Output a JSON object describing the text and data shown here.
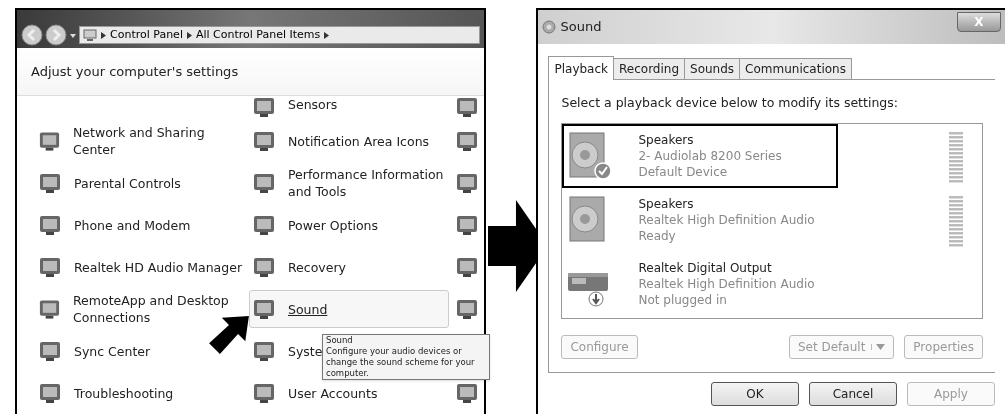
{
  "control_panel": {
    "breadcrumbs": [
      "Control Panel",
      "All Control Panel Items"
    ],
    "heading": "Adjust your computer's settings",
    "rows": [
      {
        "left": null,
        "middle": {
          "label": "Sensors",
          "selected": false
        }
      },
      {
        "left": {
          "label": "Network and Sharing Center",
          "selected": false
        },
        "middle": {
          "label": "Notification Area Icons",
          "selected": false
        }
      },
      {
        "left": {
          "label": "Parental Controls",
          "selected": false
        },
        "middle": {
          "label": "Performance Information and Tools",
          "selected": false
        }
      },
      {
        "left": {
          "label": "Phone and Modem",
          "selected": false
        },
        "middle": {
          "label": "Power Options",
          "selected": false
        }
      },
      {
        "left": {
          "label": "Realtek HD Audio Manager",
          "selected": false
        },
        "middle": {
          "label": "Recovery",
          "selected": false
        }
      },
      {
        "left": {
          "label": "RemoteApp and Desktop Connections",
          "selected": false
        },
        "middle": {
          "label": "Sound",
          "selected": true
        }
      },
      {
        "left": {
          "label": "Sync Center",
          "selected": false
        },
        "middle": {
          "label": "Syste",
          "selected": false
        }
      },
      {
        "left": {
          "label": "Troubleshooting",
          "selected": false
        },
        "middle": {
          "label": "User Accounts",
          "selected": false
        }
      }
    ],
    "tooltip": {
      "title": "Sound",
      "text": "Configure your audio devices or change the sound scheme for your computer."
    }
  },
  "sound_dialog": {
    "title": "Sound",
    "close": "X",
    "tabs": [
      {
        "label": "Playback",
        "selected": true
      },
      {
        "label": "Recording",
        "selected": false
      },
      {
        "label": "Sounds",
        "selected": false
      },
      {
        "label": "Communications",
        "selected": false
      }
    ],
    "instruction": "Select a playback device below to modify its settings:",
    "devices": [
      {
        "kind": "speaker",
        "name": "Speakers",
        "description": "2- Audiolab 8200 Series",
        "status": "Default Device",
        "default": true,
        "unplugged": false,
        "selected": true
      },
      {
        "kind": "speaker",
        "name": "Speakers",
        "description": "Realtek High Definition Audio",
        "status": "Ready",
        "default": false,
        "unplugged": false,
        "selected": false
      },
      {
        "kind": "digital-output",
        "name": "Realtek Digital Output",
        "description": "Realtek High Definition Audio",
        "status": "Not plugged in",
        "default": false,
        "unplugged": true,
        "selected": false
      }
    ],
    "device_buttons": [
      {
        "label": "Configure",
        "disabled": true,
        "dropdown": false
      },
      {
        "label": "Set Default",
        "disabled": true,
        "dropdown": true
      },
      {
        "label": "Properties",
        "disabled": true,
        "dropdown": false
      }
    ],
    "footer_buttons": [
      {
        "label": "OK",
        "disabled": false
      },
      {
        "label": "Cancel",
        "disabled": false
      },
      {
        "label": "Apply",
        "disabled": true
      }
    ]
  }
}
